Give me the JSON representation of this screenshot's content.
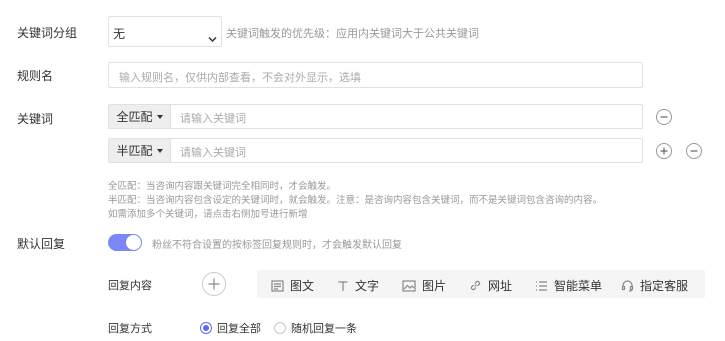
{
  "keyword_group": {
    "label": "关键词分组",
    "select_value": "无",
    "hint": "关键词触发的优先级：应用内关键词大于公共关键词"
  },
  "rule_name": {
    "label": "规则名",
    "placeholder": "输入规则名，仅供内部查看，不会对外显示，选填"
  },
  "keywords": {
    "label": "关键词",
    "rows": [
      {
        "match": "全匹配",
        "placeholder": "请输入关键词"
      },
      {
        "match": "半匹配",
        "placeholder": "请输入关键词"
      }
    ],
    "notes": [
      "全匹配：当咨询内容跟关键词完全相同时，才会触发。",
      "半匹配：当咨询内容包含设定的关键词时，就会触发。注意：是咨询内容包含关键词，而不是关键词包含咨询的内容。",
      "如需添加多个关键词，请点击右侧加号进行新增"
    ]
  },
  "default_reply": {
    "label": "默认回复",
    "enabled": true,
    "hint": "粉丝不符合设置的按标签回复规则时，才会触发默认回复"
  },
  "reply_content": {
    "label": "回复内容",
    "types": [
      {
        "label": "图文",
        "icon": "image-text-icon"
      },
      {
        "label": "文字",
        "icon": "text-icon"
      },
      {
        "label": "图片",
        "icon": "picture-icon"
      },
      {
        "label": "网址",
        "icon": "link-icon"
      },
      {
        "label": "智能菜单",
        "icon": "menu-icon"
      },
      {
        "label": "指定客服",
        "icon": "headset-icon"
      }
    ]
  },
  "reply_mode": {
    "label": "回复方式",
    "options": [
      {
        "label": "回复全部",
        "selected": true
      },
      {
        "label": "随机回复一条",
        "selected": false
      }
    ]
  },
  "colors": {
    "accent": "#5b6cf0",
    "toggle": "#7b86f7"
  }
}
